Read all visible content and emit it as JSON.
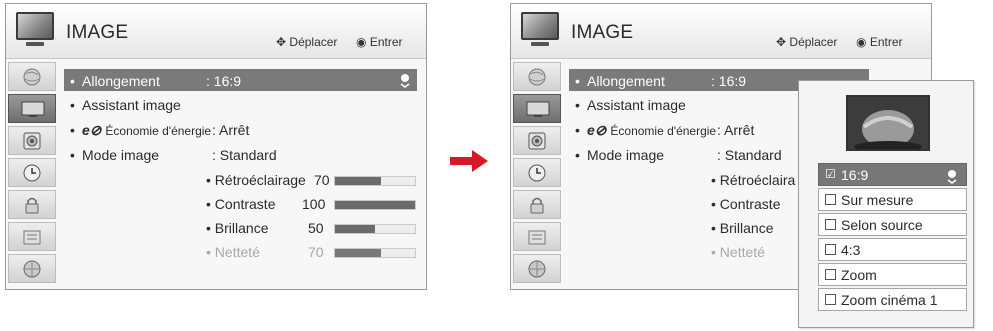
{
  "menu": {
    "title": "IMAGE",
    "hint_move": "Déplacer",
    "hint_enter": "Entrer",
    "rows": [
      {
        "label": "Allongement",
        "value": ": 16:9"
      },
      {
        "label": "Assistant image",
        "value": ""
      },
      {
        "label": "Économie d'énergie",
        "value": ": Arrêt",
        "prefix_icon": "eco-icon"
      },
      {
        "label": "Mode image",
        "value": ": Standard"
      }
    ],
    "sub_settings": [
      {
        "label": "• Rétroéclairage",
        "value": "70",
        "level": 70
      },
      {
        "label": "• Contraste",
        "value": "100",
        "level": 100
      },
      {
        "label": "• Brillance",
        "value": "50",
        "level": 50
      },
      {
        "label": "• Netteté",
        "value": "70",
        "level": 70
      }
    ],
    "sidebar_icons": [
      "globe-icon",
      "screen-icon",
      "speaker-icon",
      "clock-icon",
      "lock-icon",
      "options-icon",
      "network-icon"
    ]
  },
  "right_menu": {
    "sub_labels": [
      "• Rétroéclaira",
      "• Contraste",
      "• Brillance",
      "• Netteté"
    ]
  },
  "popup": {
    "options": [
      "16:9",
      "Sur mesure",
      "Selon source",
      "4:3",
      "Zoom",
      "Zoom cinéma 1"
    ],
    "selected_index": 0
  },
  "colors": {
    "selected_row": "#7a7a7a",
    "arrow": "#d6182a"
  }
}
